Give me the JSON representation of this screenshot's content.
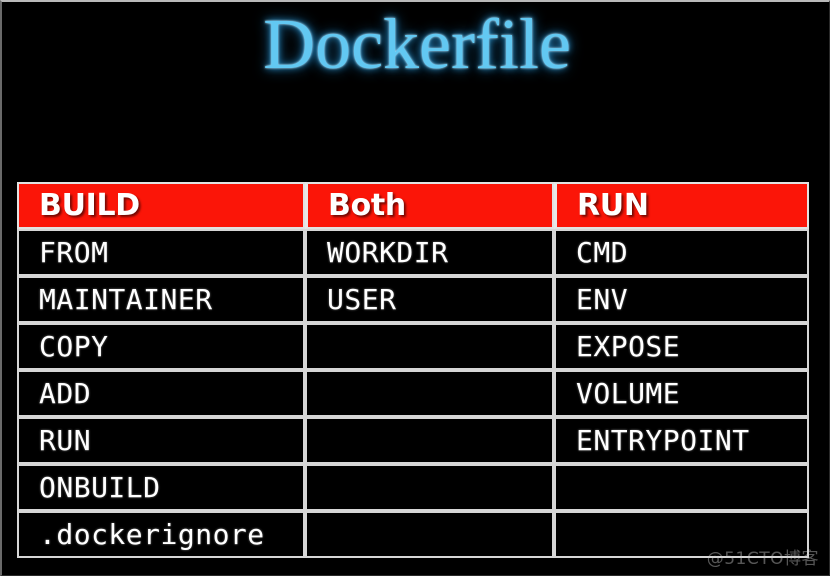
{
  "slide": {
    "title": "Dockerfile",
    "background_color": "#000000",
    "title_color": "#62c8f2"
  },
  "table": {
    "header_bg_color": "#fb1508",
    "header_text_color": "#ffffff",
    "border_color": "#d6d6d6",
    "headers": [
      "BUILD",
      "Both",
      "RUN"
    ],
    "rows": [
      [
        "FROM",
        "WORKDIR",
        "CMD"
      ],
      [
        "MAINTAINER",
        "USER",
        "ENV"
      ],
      [
        "COPY",
        "",
        "EXPOSE"
      ],
      [
        "ADD",
        "",
        "VOLUME"
      ],
      [
        "RUN",
        "",
        "ENTRYPOINT"
      ],
      [
        "ONBUILD",
        "",
        ""
      ],
      [
        ".dockerignore",
        "",
        ""
      ]
    ]
  },
  "watermark": {
    "text": "@51CTO博客"
  }
}
